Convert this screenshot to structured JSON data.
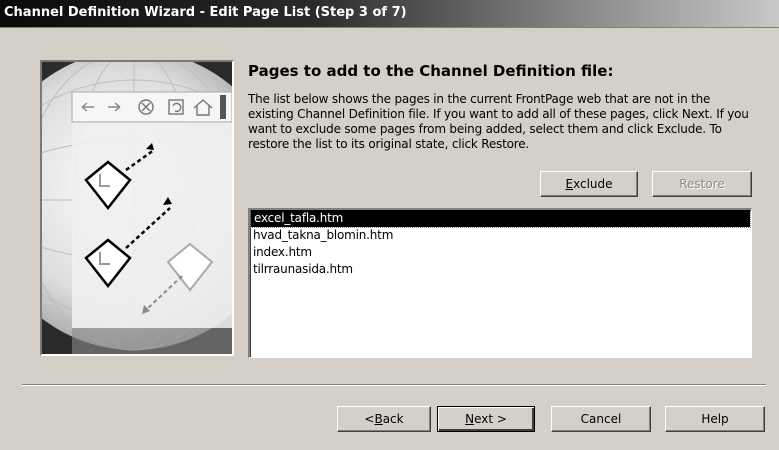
{
  "window": {
    "title": "Channel Definition Wizard - Edit Page List (Step 3 of 7)"
  },
  "heading": "Pages to add to the Channel Definition file:",
  "description": "The list below shows the pages in the current FrontPage web that are not in the existing Channel Definition file.  If you want to add all of these pages, click Next.  If you want to exclude some pages from being added, select them and click Exclude.  To restore the list to its original state, click Restore.",
  "buttons": {
    "exclude": {
      "mnemonic": "E",
      "rest": "xclude"
    },
    "restore": "Restore",
    "back": {
      "prefix": "< ",
      "mnemonic": "B",
      "rest": "ack"
    },
    "next": {
      "mnemonic": "N",
      "rest": "ext >"
    },
    "cancel": "Cancel",
    "help": "Help"
  },
  "pages": {
    "selected_index": 0,
    "items": [
      "excel_tafla.htm",
      "hvad_takna_blomin.htm",
      "index.htm",
      "tilrraunasida.htm"
    ]
  }
}
